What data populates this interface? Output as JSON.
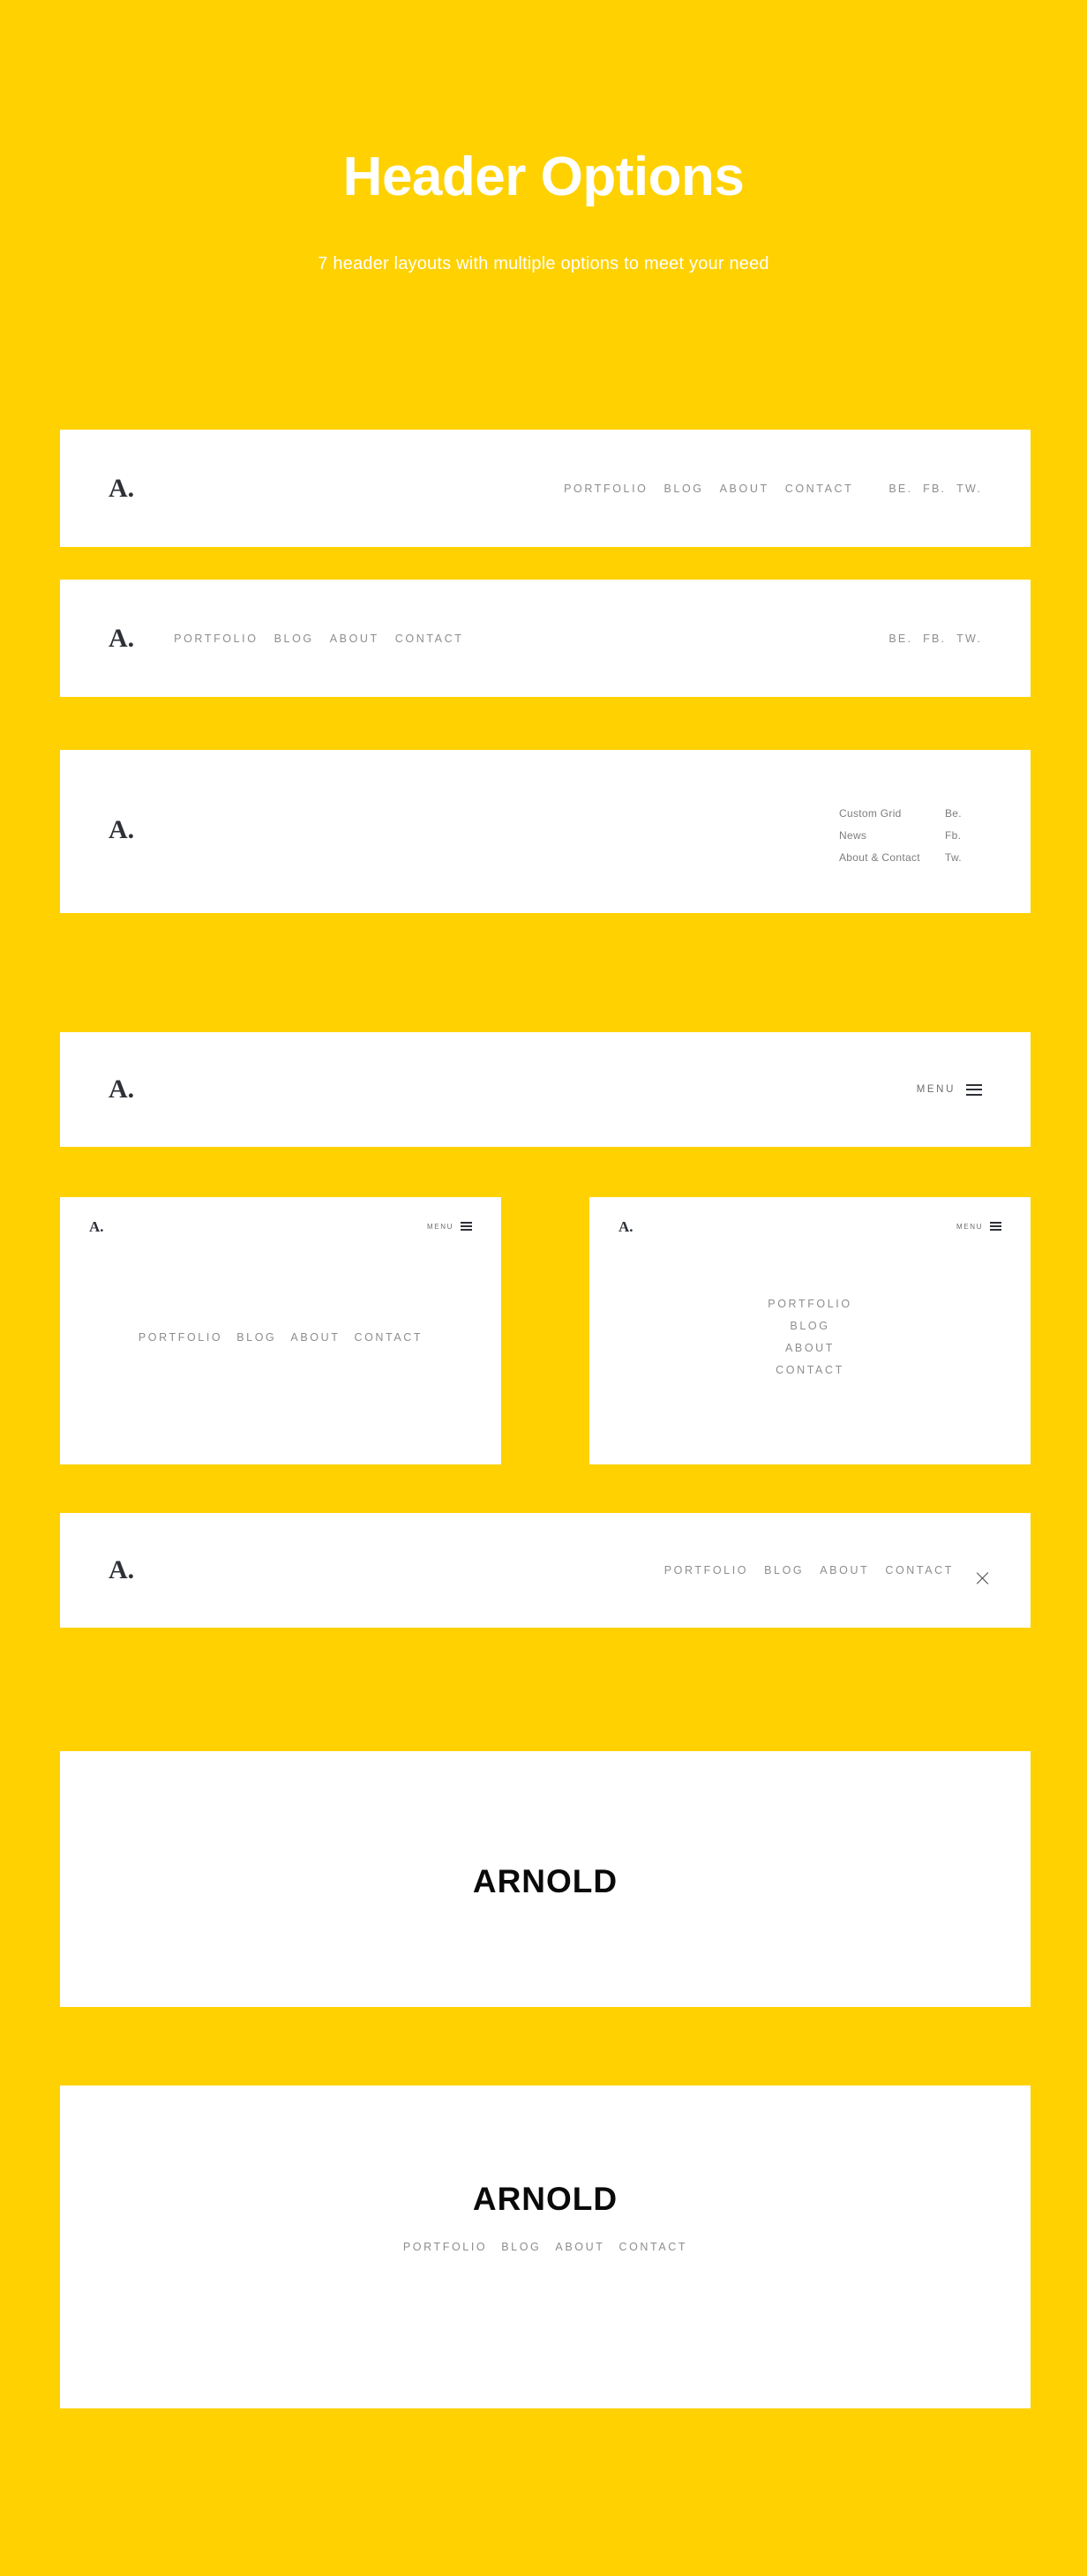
{
  "theme": {
    "background": "#ffd100",
    "card_background": "#ffffff",
    "nav_text": "#8d8d8d",
    "logo_text": "#2e3038",
    "wordmark_text": "#0a0a0a"
  },
  "hero": {
    "title": "Header Options",
    "subtitle": "7 header layouts with multiple options to meet your need"
  },
  "logo": {
    "text": "A."
  },
  "nav": {
    "portfolio": "PORTFOLIO",
    "blog": "BLOG",
    "about": "ABOUT",
    "contact": "CONTACT"
  },
  "social": {
    "be": "BE.",
    "fb": "FB.",
    "tw": "TW."
  },
  "grid_menu": {
    "col1": [
      "Custom Grid",
      "News",
      "About & Contact"
    ],
    "col2": [
      "Be.",
      "Fb.",
      "Tw."
    ]
  },
  "menu_toggle": {
    "label": "MENU",
    "icon": "hamburger-icon"
  },
  "close": {
    "icon": "close-icon"
  },
  "wordmark": {
    "text": "ARNOLD"
  },
  "headers": [
    {
      "id": "header-1",
      "name": "logo-left-nav-right-with-social"
    },
    {
      "id": "header-2",
      "name": "logo-left-nav-inline-social-right"
    },
    {
      "id": "header-3",
      "name": "logo-left-custom-grid-right"
    },
    {
      "id": "header-4",
      "name": "logo-left-menu-toggle-right"
    },
    {
      "id": "header-5",
      "name": "menu-toggle-horizontal-nav"
    },
    {
      "id": "header-6",
      "name": "menu-toggle-vertical-nav"
    },
    {
      "id": "header-7",
      "name": "logo-left-nav-right-close"
    },
    {
      "id": "header-8",
      "name": "centered-wordmark"
    },
    {
      "id": "header-9",
      "name": "centered-wordmark-with-nav"
    }
  ]
}
